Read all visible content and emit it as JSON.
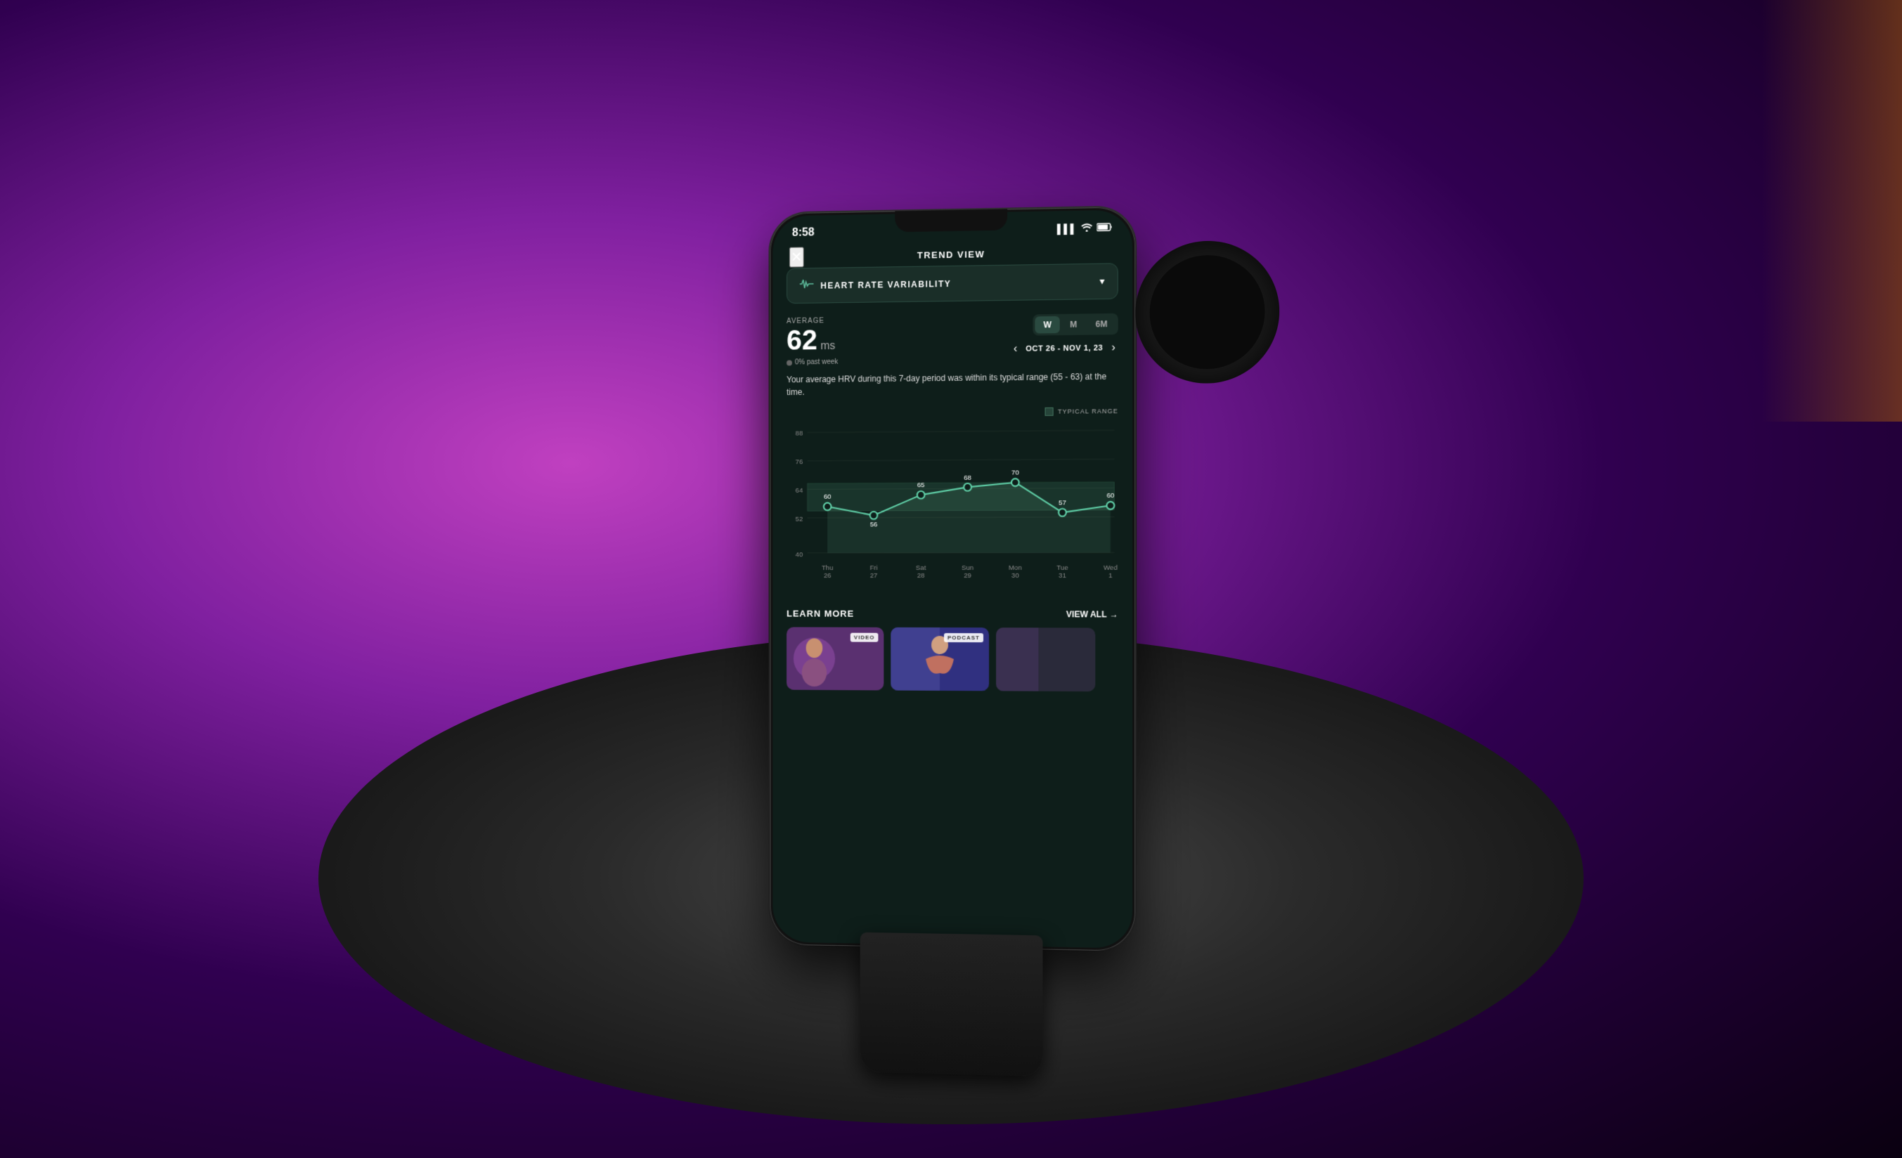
{
  "background": {
    "color": "#2a0840"
  },
  "status_bar": {
    "time": "8:58",
    "signal": "▌▌▌",
    "wifi": "wifi",
    "battery": "battery"
  },
  "header": {
    "title": "TREND VIEW",
    "close_label": "✕"
  },
  "hrv_selector": {
    "icon": "⚡",
    "label": "HEART RATE VARIABILITY",
    "chevron": "▾"
  },
  "stats": {
    "average_label": "AVERAGE",
    "average_value": "62",
    "average_unit": "ms",
    "change_text": "0% past week"
  },
  "period_tabs": [
    {
      "label": "W",
      "active": true
    },
    {
      "label": "M",
      "active": false
    },
    {
      "label": "6M",
      "active": false
    }
  ],
  "date_range": {
    "text": "OCT 26 - NOV 1, 23",
    "prev_label": "‹",
    "next_label": "›"
  },
  "description": "Your average HRV during this 7-day period was within its typical range (55 - 63) at the time.",
  "chart": {
    "legend_label": "TYPICAL RANGE",
    "y_labels": [
      "88",
      "76",
      "64",
      "52",
      "40"
    ],
    "data_points": [
      {
        "day": "Thu",
        "date": "26",
        "value": 60,
        "label": "60"
      },
      {
        "day": "Fri",
        "date": "27",
        "value": 56,
        "label": "56"
      },
      {
        "day": "Sat",
        "date": "28",
        "value": 65,
        "label": "65"
      },
      {
        "day": "Sun",
        "date": "29",
        "value": 68,
        "label": "68"
      },
      {
        "day": "Mon",
        "date": "30",
        "value": 70,
        "label": "70"
      },
      {
        "day": "Tue",
        "date": "31",
        "value": 57,
        "label": "57"
      },
      {
        "day": "Wed",
        "date": "1",
        "value": 60,
        "label": "60"
      }
    ],
    "typical_range_min": 55,
    "typical_range_max": 63,
    "y_min": 40,
    "y_max": 92
  },
  "learn_more": {
    "title": "LEARN MORE",
    "view_all": "VIEW ALL",
    "arrow": "→"
  },
  "media_cards": [
    {
      "type": "VIDEO",
      "bg": "#4a3060"
    },
    {
      "type": "PODCAST",
      "bg": "#303060"
    },
    {
      "type": null,
      "bg": "#2a2a2a"
    }
  ]
}
